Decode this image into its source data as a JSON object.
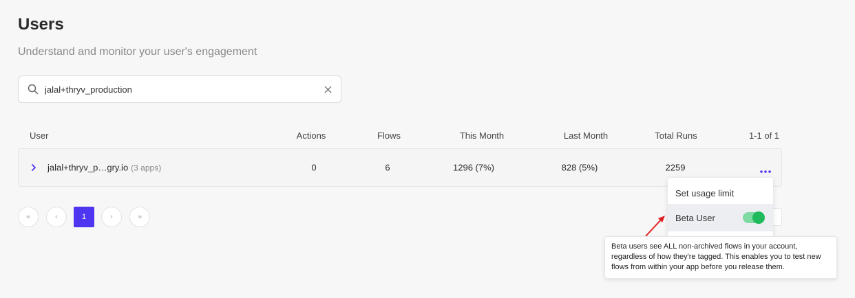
{
  "page": {
    "title": "Users",
    "subtitle": "Understand and monitor your user's engagement"
  },
  "search": {
    "value": "jalal+thryv_production",
    "placeholder": "",
    "icon": "search-icon",
    "clear_icon": "close-icon"
  },
  "table": {
    "headers": {
      "user": "User",
      "actions": "Actions",
      "flows": "Flows",
      "this_month": "This Month",
      "last_month": "Last Month",
      "total_runs": "Total Runs",
      "range": "1-1 of 1"
    },
    "rows": [
      {
        "user": "jalal+thryv_p…gry.io",
        "apps": "(3 apps)",
        "actions": "0",
        "flows": "6",
        "this_month": "1296 (7%)",
        "last_month": "828 (5%)",
        "total_runs": "2259"
      }
    ]
  },
  "pagination": {
    "first": "«",
    "prev": "‹",
    "current": "1",
    "next": "›",
    "last": "»"
  },
  "menu": {
    "set_usage_limit": "Set usage limit",
    "beta_user": "Beta User",
    "beta_user_enabled": true
  },
  "tooltip": {
    "text": "Beta users see ALL non-archived flows in your account, regardless of how they're tagged. This enables you to test new flows from within your app before you release them."
  },
  "colors": {
    "accent": "#4e35f0",
    "toggle_on": "#1fba5c",
    "annotation_arrow": "#e02020"
  }
}
